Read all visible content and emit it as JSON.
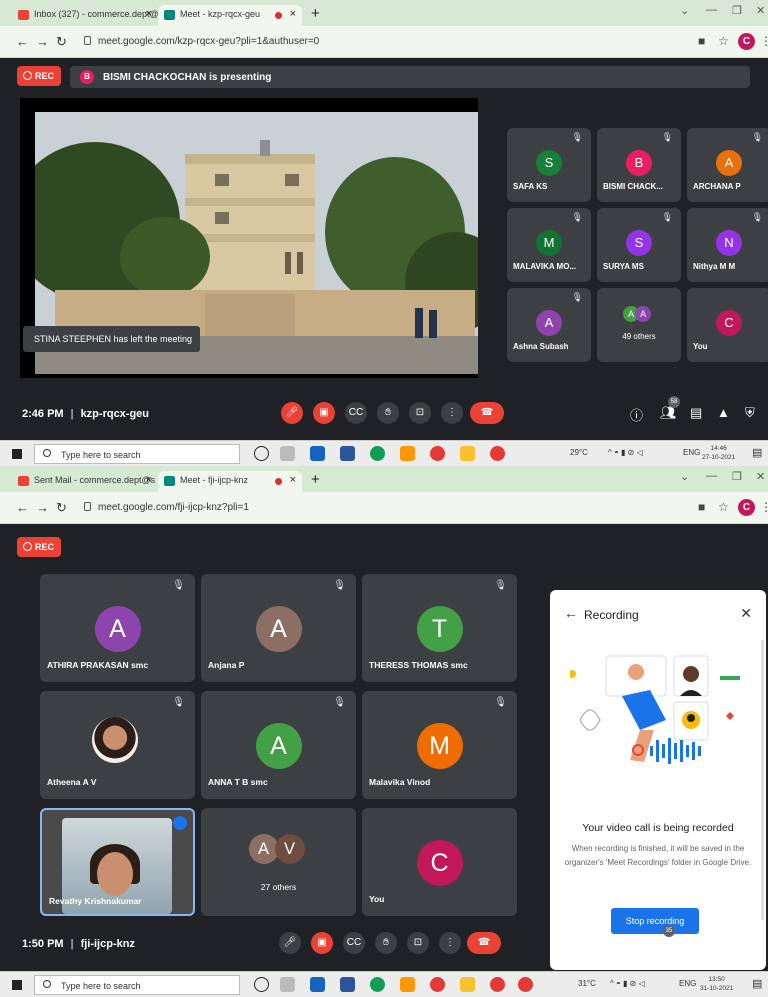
{
  "shot1": {
    "tabs": [
      {
        "title": "Inbox (327) - commerce.dept@s",
        "close": "×"
      },
      {
        "title": "Meet - kzp-rqcx-geu",
        "close": "×"
      }
    ],
    "new_tab": "+",
    "url": "meet.google.com/kzp-rqcx-geu?pli=1&authuser=0",
    "rec_label": "REC",
    "presenter_initial": "B",
    "presenting_text": "BISMI CHACKOCHAN is presenting",
    "toast": "STINA STEEPHEN has left the meeting",
    "participants": [
      {
        "initial": "S",
        "name": "SAFA KS",
        "color": "#188038"
      },
      {
        "initial": "B",
        "name": "BISMI CHACK...",
        "color": "#e91e63"
      },
      {
        "initial": "A",
        "name": "ARCHANA P",
        "color": "#e8710a"
      },
      {
        "initial": "M",
        "name": "MALAVIKA MO...",
        "color": "#137333"
      },
      {
        "initial": "S",
        "name": "SURYA MS",
        "color": "#9334e6"
      },
      {
        "initial": "N",
        "name": "Nithya M M",
        "color": "#9334e6"
      },
      {
        "initial": "A",
        "name": "Ashna Subash",
        "color": "#8e44ad"
      },
      {
        "initial": "",
        "name": "49 others",
        "color": "#3c4043",
        "others": [
          "A",
          "A"
        ]
      },
      {
        "initial": "C",
        "name": "You",
        "color": "#c2185b"
      }
    ],
    "time": "2:46 PM",
    "meeting_code": "kzp-rqcx-geu",
    "people_count": "58",
    "taskbar": {
      "search": "Type here to search",
      "temp": "29°C",
      "lang": "ENG",
      "time": "14:46",
      "date": "27-10-2021"
    }
  },
  "shot2": {
    "tabs": [
      {
        "title": "Sent Mail - commerce.dept@s",
        "close": "×"
      },
      {
        "title": "Meet - fji-ijcp-knz",
        "close": "×"
      }
    ],
    "new_tab": "+",
    "url": "meet.google.com/fji-ijcp-knz?pli=1",
    "rec_label": "REC",
    "participants": [
      {
        "initial": "A",
        "name": "ATHIRA PRAKASAN smc",
        "color": "#8e44ad"
      },
      {
        "initial": "A",
        "name": "Anjana P",
        "color": "#8d6e63"
      },
      {
        "initial": "T",
        "name": "THERESS THOMAS smc",
        "color": "#43a047"
      },
      {
        "initial": "",
        "name": "Atheena A V",
        "color": "#3c4043",
        "photo": true
      },
      {
        "initial": "A",
        "name": "ANNA T B smc",
        "color": "#43a047"
      },
      {
        "initial": "M",
        "name": "Malavika Vinod",
        "color": "#ef6c00"
      },
      {
        "initial": "",
        "name": "Revathy Krishnakumar",
        "color": "#3c4043",
        "video": true
      },
      {
        "initial": "",
        "name": "27 others",
        "color": "#3c4043",
        "others": [
          "A",
          "V"
        ]
      },
      {
        "initial": "C",
        "name": "You",
        "color": "#c2185b"
      }
    ],
    "time": "1:50 PM",
    "meeting_code": "fji-ijcp-knz",
    "people_count": "35",
    "recording_panel": {
      "title": "Recording",
      "headline": "Your video call is being recorded",
      "description": "When recording is finished, it will be saved in the organizer's 'Meet Recordings' folder in Google Drive.",
      "button": "Stop recording"
    },
    "taskbar": {
      "search": "Type here to search",
      "temp": "31°C",
      "lang": "ENG",
      "time": "13:50",
      "date": "31-10-2021"
    }
  },
  "colors": {
    "meet_bg": "#202124",
    "tile_bg": "#3c4043",
    "rec_red": "#ea4335",
    "stop_blue": "#1a73e8"
  }
}
